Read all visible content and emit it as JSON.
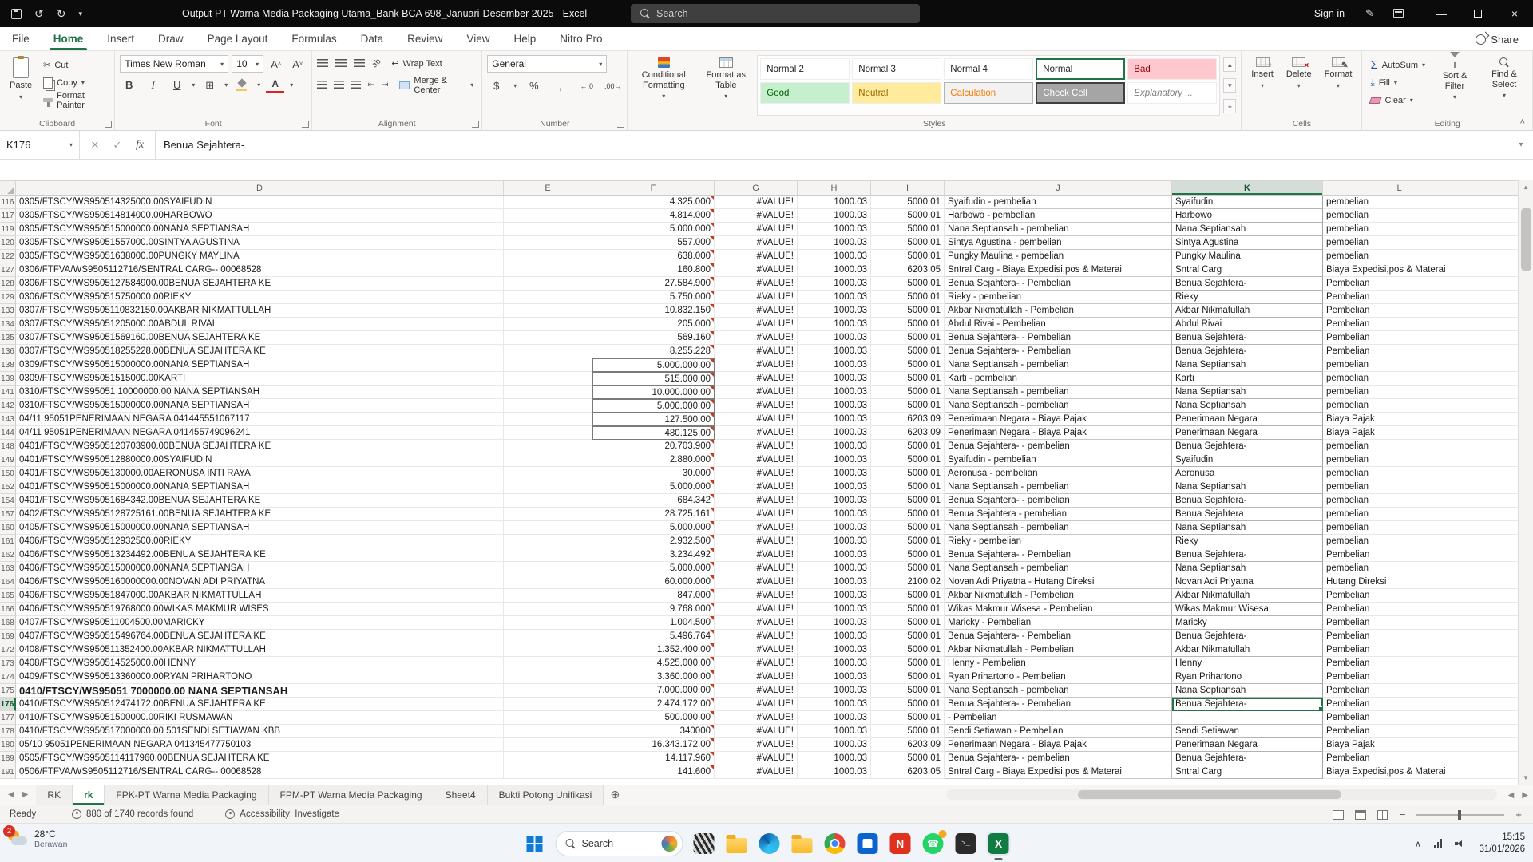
{
  "window": {
    "title": "Output PT Warna Media Packaging Utama_Bank BCA 698_Januari-Desember 2025  -  Excel",
    "search_placeholder": "Search",
    "sign_in": "Sign in"
  },
  "ribbon": {
    "tabs": [
      {
        "label": "File"
      },
      {
        "label": "Home",
        "active": true
      },
      {
        "label": "Insert"
      },
      {
        "label": "Draw"
      },
      {
        "label": "Page Layout"
      },
      {
        "label": "Formulas"
      },
      {
        "label": "Data"
      },
      {
        "label": "Review"
      },
      {
        "label": "View"
      },
      {
        "label": "Help"
      },
      {
        "label": "Nitro Pro"
      }
    ],
    "share_label": "Share",
    "clipboard": {
      "group": "Clipboard",
      "paste": "Paste",
      "cut": "Cut",
      "copy": "Copy",
      "format_painter": "Format Painter"
    },
    "font": {
      "group": "Font",
      "family": "Times New Roman",
      "size": "10"
    },
    "alignment": {
      "group": "Alignment",
      "wrap_text": "Wrap Text",
      "merge_center": "Merge & Center"
    },
    "number": {
      "group": "Number",
      "format": "General"
    },
    "styles": {
      "group": "Styles",
      "conditional_formatting": "Conditional Formatting",
      "format_as_table": "Format as Table",
      "gallery": [
        {
          "label": "Normal 2",
          "style": "plain"
        },
        {
          "label": "Normal 3",
          "style": "plain"
        },
        {
          "label": "Normal 4",
          "style": "plain"
        },
        {
          "label": "Normal",
          "style": "selected"
        },
        {
          "label": "Bad",
          "style": "bad"
        },
        {
          "label": "Good",
          "style": "good"
        },
        {
          "label": "Neutral",
          "style": "neutral"
        },
        {
          "label": "Calculation",
          "style": "calc"
        },
        {
          "label": "Check Cell",
          "style": "check"
        },
        {
          "label": "Explanatory ...",
          "style": "expl"
        }
      ]
    },
    "cells": {
      "group": "Cells",
      "insert": "Insert",
      "delete": "Delete",
      "format": "Format"
    },
    "editing": {
      "group": "Editing",
      "autosum": "AutoSum",
      "fill": "Fill",
      "clear": "Clear",
      "sort_filter": "Sort & Filter",
      "find_select": "Find & Select"
    }
  },
  "formula_bar": {
    "name_box": "K176",
    "value": "Benua Sejahtera-"
  },
  "sheet": {
    "columns": [
      "D",
      "E",
      "F",
      "G",
      "H",
      "I",
      "J",
      "K",
      "L"
    ],
    "selected_column": "K",
    "selected_row": "176",
    "defaults": {
      "g": "#VALUE!",
      "h": "1000.03"
    },
    "rows": [
      {
        "n": "116",
        "d": "0305/FTSCY/WS950514325000.00SYAIFUDIN",
        "f": "4.325.000",
        "i": "5000.01",
        "j": "Syaifudin - pembelian",
        "k": "Syaifudin",
        "l": "pembelian"
      },
      {
        "n": "117",
        "d": "0305/FTSCY/WS950514814000.00HARBOWO",
        "f": "4.814.000",
        "i": "5000.01",
        "j": "Harbowo - pembelian",
        "k": "Harbowo",
        "l": "pembelian"
      },
      {
        "n": "119",
        "d": "0305/FTSCY/WS950515000000.00NANA SEPTIANSAH",
        "f": "5.000.000",
        "i": "5000.01",
        "j": "Nana Septiansah - pembelian",
        "k": "Nana Septiansah",
        "l": "pembelian"
      },
      {
        "n": "120",
        "d": "0305/FTSCY/WS95051557000.00SINTYA AGUSTINA",
        "f": "557.000",
        "i": "5000.01",
        "j": "Sintya Agustina - pembelian",
        "k": "Sintya Agustina",
        "l": "pembelian"
      },
      {
        "n": "122",
        "d": "0305/FTSCY/WS95051638000.00PUNGKY MAYLINA",
        "f": "638.000",
        "i": "5000.01",
        "j": "Pungky Maulina - pembelian",
        "k": "Pungky Maulina",
        "l": "pembelian"
      },
      {
        "n": "127",
        "d": "0306/FTFVA/WS9505112716/SENTRAL CARG-- 00068528",
        "f": "160.800",
        "i": "6203.05",
        "j": "Sntral Carg - Biaya Expedisi,pos & Materai",
        "k": "Sntral Carg",
        "l": "Biaya Expedisi,pos & Materai"
      },
      {
        "n": "128",
        "d": "0306/FTSCY/WS9505127584900.00BENUA SEJAHTERA KE",
        "f": "27.584.900",
        "i": "5000.01",
        "j": "Benua Sejahtera- - Pembelian",
        "k": "Benua Sejahtera-",
        "l": "Pembelian"
      },
      {
        "n": "129",
        "d": "0306/FTSCY/WS950515750000.00RIEKY",
        "f": "5.750.000",
        "i": "5000.01",
        "j": "Rieky - pembelian",
        "k": "Rieky",
        "l": "Pembelian"
      },
      {
        "n": "133",
        "d": "0307/FTSCY/WS9505110832150.00AKBAR NIKMATTULLAH",
        "f": "10.832.150",
        "i": "5000.01",
        "j": "Akbar Nikmatullah - Pembelian",
        "k": "Akbar Nikmatullah",
        "l": "Pembelian"
      },
      {
        "n": "134",
        "d": "0307/FTSCY/WS95051205000.00ABDUL RIVAI",
        "f": "205.000",
        "i": "5000.01",
        "j": "Abdul Rivai - Pembelian",
        "k": "Abdul Rivai",
        "l": "Pembelian"
      },
      {
        "n": "135",
        "d": "0307/FTSCY/WS95051569160.00BENUA SEJAHTERA KE",
        "f": "569.160",
        "i": "5000.01",
        "j": "Benua Sejahtera- - Pembelian",
        "k": "Benua Sejahtera-",
        "l": "Pembelian"
      },
      {
        "n": "136",
        "d": "0307/FTSCY/WS950518255228.00BENUA SEJAHTERA KE",
        "f": "8.255.228",
        "i": "5000.01",
        "j": "Benua Sejahtera- - Pembelian",
        "k": "Benua Sejahtera-",
        "l": "Pembelian"
      },
      {
        "n": "138",
        "d": "0309/FTSCY/WS950515000000.00NANA SEPTIANSAH",
        "f": "5.000.000,00",
        "fbox": true,
        "i": "5000.01",
        "j": "Nana Septiansah - pembelian",
        "k": "Nana Septiansah",
        "l": "pembelian"
      },
      {
        "n": "139",
        "d": "0309/FTSCY/WS95051515000.00KARTI",
        "f": "515.000,00",
        "fbox": true,
        "i": "5000.01",
        "j": "Karti - pembelian",
        "k": "Karti",
        "l": "pembelian"
      },
      {
        "n": "141",
        "d": "0310/FTSCY/WS95051 10000000.00 NANA SEPTIANSAH",
        "f": "10.000.000,00",
        "fbox": true,
        "i": "5000.01",
        "j": "Nana Septiansah - pembelian",
        "k": "Nana Septiansah",
        "l": "pembelian"
      },
      {
        "n": "142",
        "d": "0310/FTSCY/WS950515000000.00NANA SEPTIANSAH",
        "f": "5.000.000,00",
        "fbox": true,
        "i": "5000.01",
        "j": "Nana Septiansah - pembelian",
        "k": "Nana Septiansah",
        "l": "pembelian"
      },
      {
        "n": "143",
        "d": "04/11 95051PENERIMAAN NEGARA 041445551067117",
        "f": "127.500,00",
        "fbox": true,
        "i": "6203.09",
        "j": "Penerimaan Negara - Biaya Pajak",
        "k": "Penerimaan Negara",
        "l": "Biaya Pajak"
      },
      {
        "n": "144",
        "d": "04/11 95051PENERIMAAN NEGARA 041455749096241",
        "f": "480.125,00",
        "fbox": true,
        "i": "6203.09",
        "j": "Penerimaan Negara - Biaya Pajak",
        "k": "Penerimaan Negara",
        "l": "Biaya Pajak"
      },
      {
        "n": "148",
        "d": "0401/FTSCY/WS9505120703900.00BENUA SEJAHTERA KE",
        "f": "20.703.900",
        "i": "5000.01",
        "j": "Benua Sejahtera- - pembelian",
        "k": "Benua Sejahtera-",
        "l": "pembelian"
      },
      {
        "n": "149",
        "d": "0401/FTSCY/WS950512880000.00SYAIFUDIN",
        "f": "2.880.000",
        "i": "5000.01",
        "j": "Syaifudin - pembelian",
        "k": "Syaifudin",
        "l": "pembelian"
      },
      {
        "n": "150",
        "d": "0401/FTSCY/WS9505130000.00AERONUSA INTI RAYA",
        "f": "30.000",
        "i": "5000.01",
        "j": "Aeronusa - pembelian",
        "k": "Aeronusa",
        "l": "pembelian"
      },
      {
        "n": "152",
        "d": "0401/FTSCY/WS950515000000.00NANA SEPTIANSAH",
        "f": "5.000.000",
        "i": "5000.01",
        "j": "Nana Septiansah - pembelian",
        "k": "Nana Septiansah",
        "l": "pembelian"
      },
      {
        "n": "154",
        "d": "0401/FTSCY/WS95051684342.00BENUA SEJAHTERA KE",
        "f": "684.342",
        "i": "5000.01",
        "j": "Benua Sejahtera- - pembelian",
        "k": "Benua Sejahtera-",
        "l": "pembelian"
      },
      {
        "n": "157",
        "d": "0402/FTSCY/WS9505128725161.00BENUA SEJAHTERA KE",
        "f": "28.725.161",
        "i": "5000.01",
        "j": "Benua Sejahtera - pembelian",
        "k": "Benua Sejahtera",
        "l": "pembelian"
      },
      {
        "n": "160",
        "d": "0405/FTSCY/WS950515000000.00NANA SEPTIANSAH",
        "f": "5.000.000",
        "i": "5000.01",
        "j": "Nana Septiansah - pembelian",
        "k": "Nana Septiansah",
        "l": "pembelian"
      },
      {
        "n": "161",
        "d": "0406/FTSCY/WS950512932500.00RIEKY",
        "f": "2.932.500",
        "i": "5000.01",
        "j": "Rieky  - pembelian",
        "k": "Rieky",
        "l": "pembelian"
      },
      {
        "n": "162",
        "d": "0406/FTSCY/WS950513234492.00BENUA SEJAHTERA KE",
        "f": "3.234.492",
        "i": "5000.01",
        "j": "Benua Sejahtera- - Pembelian",
        "k": "Benua Sejahtera-",
        "l": "Pembelian"
      },
      {
        "n": "163",
        "d": "0406/FTSCY/WS950515000000.00NANA SEPTIANSAH",
        "f": "5.000.000",
        "i": "5000.01",
        "j": "Nana Septiansah - pembelian",
        "k": "Nana Septiansah",
        "l": "pembelian"
      },
      {
        "n": "164",
        "d": "0406/FTSCY/WS9505160000000.00NOVAN ADI PRIYATNA",
        "f": "60.000.000",
        "i": "2100.02",
        "j": "Novan Adi Priyatna - Hutang Direksi",
        "k": "Novan Adi Priyatna",
        "l": "Hutang Direksi"
      },
      {
        "n": "165",
        "d": "0406/FTSCY/WS95051847000.00AKBAR NIKMATTULLAH",
        "f": "847.000",
        "i": "5000.01",
        "j": "Akbar Nikmatullah - Pembelian",
        "k": "Akbar Nikmatullah",
        "l": "Pembelian"
      },
      {
        "n": "166",
        "d": "0406/FTSCY/WS950519768000.00WIKAS MAKMUR WISES",
        "f": "9.768.000",
        "i": "5000.01",
        "j": "Wikas Makmur Wisesa - Pembelian",
        "k": "Wikas Makmur Wisesa",
        "l": "Pembelian"
      },
      {
        "n": "168",
        "d": "0407/FTSCY/WS950511004500.00MARICKY",
        "f": "1.004.500",
        "i": "5000.01",
        "j": "Maricky - Pembelian",
        "k": "Maricky",
        "l": "Pembelian"
      },
      {
        "n": "169",
        "d": "0407/FTSCY/WS950515496764.00BENUA SEJAHTERA KE",
        "f": "5.496.764",
        "i": "5000.01",
        "j": "Benua Sejahtera- - Pembelian",
        "k": "Benua Sejahtera-",
        "l": "Pembelian"
      },
      {
        "n": "172",
        "d": "0408/FTSCY/WS950511352400.00AKBAR NIKMATTULLAH",
        "f": "1.352.400.00",
        "i": "5000.01",
        "j": "Akbar Nikmatullah - Pembelian",
        "k": "Akbar Nikmatullah",
        "l": "Pembelian"
      },
      {
        "n": "173",
        "d": "0408/FTSCY/WS950514525000.00HENNY",
        "f": "4.525.000.00",
        "i": "5000.01",
        "j": "Henny - Pembelian",
        "k": "Henny",
        "l": "Pembelian"
      },
      {
        "n": "174",
        "d": "0409/FTSCY/WS950513360000.00RYAN PRIHARTONO",
        "f": "3.360.000.00",
        "i": "5000.01",
        "j": "Ryan Prihartono - Pembelian",
        "k": "Ryan Prihartono",
        "l": "Pembelian"
      },
      {
        "n": "175",
        "d": "0410/FTSCY/WS95051 7000000.00 NANA SEPTIANSAH",
        "bold": true,
        "f": "7.000.000.00",
        "i": "5000.01",
        "j": "Nana Septiansah - pembelian",
        "k": "Nana Septiansah",
        "l": "Pembelian"
      },
      {
        "n": "176",
        "d": "0410/FTSCY/WS950512474172.00BENUA SEJAHTERA KE",
        "f": "2.474.172.00",
        "i": "5000.01",
        "j": "Benua Sejahtera- - Pembelian",
        "k": "Benua Sejahtera-",
        "l": "Pembelian"
      },
      {
        "n": "177",
        "d": "0410/FTSCY/WS95051500000.00RIKI RUSMAWAN",
        "f": "500.000.00",
        "i": "5000.01",
        "j": " - Pembelian",
        "k": "",
        "l": "Pembelian"
      },
      {
        "n": "178",
        "d": "0410/FTSCY/WS950517000000.00 501SENDI SETIAWAN KBB",
        "f": "340000",
        "i": "5000.01",
        "j": "Sendi Setiawan - Pembelian",
        "k": "Sendi Setiawan",
        "l": "Pembelian"
      },
      {
        "n": "180",
        "d": "05/10 95051PENERIMAAN NEGARA 041345477750103",
        "f": "16.343.172.00",
        "i": "6203.09",
        "j": "Penerimaan Negara - Biaya Pajak",
        "k": "Penerimaan Negara",
        "l": "Biaya Pajak"
      },
      {
        "n": "189",
        "d": "0505/FTSCY/WS9505114117960.00BENUA SEJAHTERA KE",
        "f": "14.117.960",
        "i": "5000.01",
        "j": "Benua Sejahtera- - pembelian",
        "k": "Benua Sejahtera-",
        "l": "Pembelian"
      },
      {
        "n": "191",
        "d": "0506/FTFVA/WS9505112716/SENTRAL CARG-- 00068528",
        "f": "141.600",
        "i": "6203.05",
        "j": "Sntral Carg - Biaya Expedisi,pos & Materai",
        "k": "Sntral Carg",
        "l": "Biaya Expedisi,pos & Materai"
      }
    ]
  },
  "sheet_tabs": {
    "items": [
      {
        "label": "RK"
      },
      {
        "label": "rk",
        "active": true
      },
      {
        "label": "FPK-PT Warna Media Packaging"
      },
      {
        "label": "FPM-PT Warna Media Packaging"
      },
      {
        "label": "Sheet4"
      },
      {
        "label": "Bukti Potong Unifikasi"
      }
    ]
  },
  "status_bar": {
    "mode": "Ready",
    "records": "880 of 1740 records found",
    "accessibility": "Accessibility: Investigate"
  },
  "taskbar": {
    "weather": {
      "temp": "28°C",
      "desc": "Berawan",
      "badge": "2"
    },
    "search_label": "Search",
    "clock": {
      "time": "15:15",
      "date": "31/01/2026"
    }
  }
}
